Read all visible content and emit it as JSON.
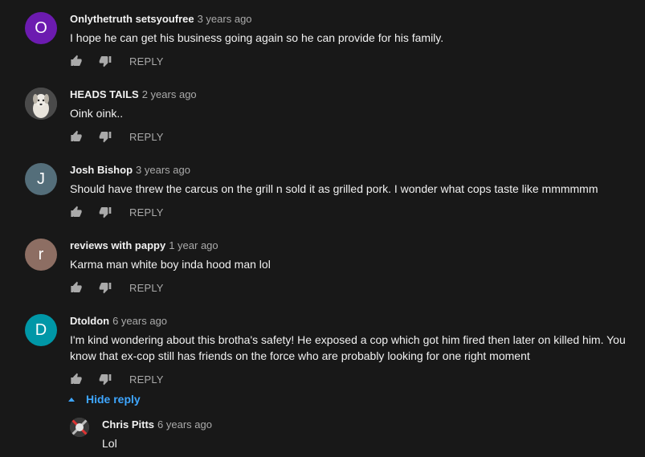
{
  "comments": [
    {
      "author": "Onlythetruth setsyoufree",
      "time": "3 years ago",
      "text": "I hope he can get his business going again so he can provide for his family.",
      "initial": "O",
      "color": "#6c1bb0",
      "reply": "REPLY"
    },
    {
      "author": "HEADS TAILS",
      "time": "2 years ago",
      "text": "Oink oink..",
      "initial": "",
      "color": "#5a5a5a",
      "reply": "REPLY"
    },
    {
      "author": "Josh Bishop",
      "time": "3 years ago",
      "text": "Should have threw the carcus on the grill n sold it as grilled pork. I wonder what cops taste like mmmmmm",
      "initial": "J",
      "color": "#546e7a",
      "reply": "REPLY"
    },
    {
      "author": "reviews with pappy",
      "time": "1 year ago",
      "text": "Karma man white boy inda hood man lol",
      "initial": "r",
      "color": "#8d6e63",
      "reply": "REPLY"
    },
    {
      "author": "Dtoldon",
      "time": "6 years ago",
      "text": "I'm kind wondering about this brotha's safety! He exposed a cop which got him fired then later on killed him. You know that ex-cop still has friends on the force who are probably looking for one right moment",
      "initial": "D",
      "color": "#0097a7",
      "reply": "REPLY"
    }
  ],
  "hide_reply_label": "Hide reply",
  "reply_comment": {
    "author": "Chris Pitts",
    "time": "6 years ago",
    "text": "Lol"
  },
  "icons": {
    "like": "thumbs-up-icon",
    "dislike": "thumbs-down-icon",
    "collapse": "caret-up-icon"
  }
}
